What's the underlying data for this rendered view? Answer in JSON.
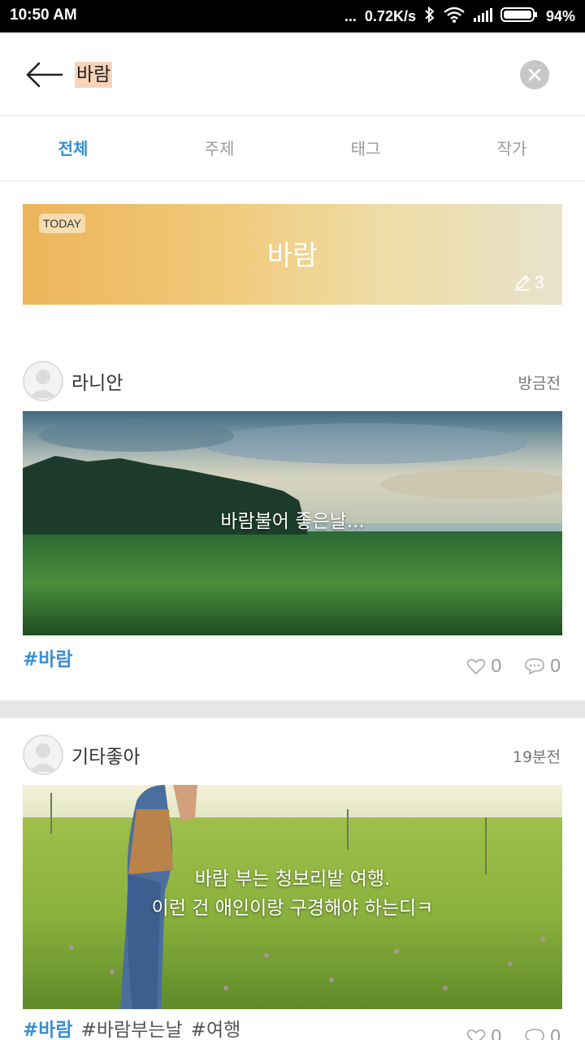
{
  "status_bar": {
    "time": "10:50 AM",
    "dots": "...",
    "net_speed": "0.72K/s",
    "battery": "94%"
  },
  "search": {
    "query": "바람"
  },
  "tabs": [
    {
      "label": "전체",
      "active": true
    },
    {
      "label": "주제",
      "active": false
    },
    {
      "label": "태그",
      "active": false
    },
    {
      "label": "작가",
      "active": false
    }
  ],
  "today_card": {
    "badge": "TODAY",
    "word": "바람",
    "count": "3"
  },
  "posts": [
    {
      "author": "라니안",
      "time_ago": "방금전",
      "caption_lines": [
        "바람불어 좋은날..."
      ],
      "tags": [
        "#바람"
      ],
      "likes": "0",
      "comments": "0"
    },
    {
      "author": "기타좋아",
      "time_ago": "19분전",
      "caption_lines": [
        "바람 부는 청보리밭 여행.",
        "이런 건 애인이랑 구경해야 하는디ㅋ"
      ],
      "tags": [
        "#바람",
        "#바람부는날",
        "#여행"
      ],
      "likes": "0",
      "comments": "0"
    }
  ],
  "colors": {
    "accent": "#2e8fd6",
    "tag": "#3d8fd1",
    "search_highlight": "#f7d3b9"
  }
}
